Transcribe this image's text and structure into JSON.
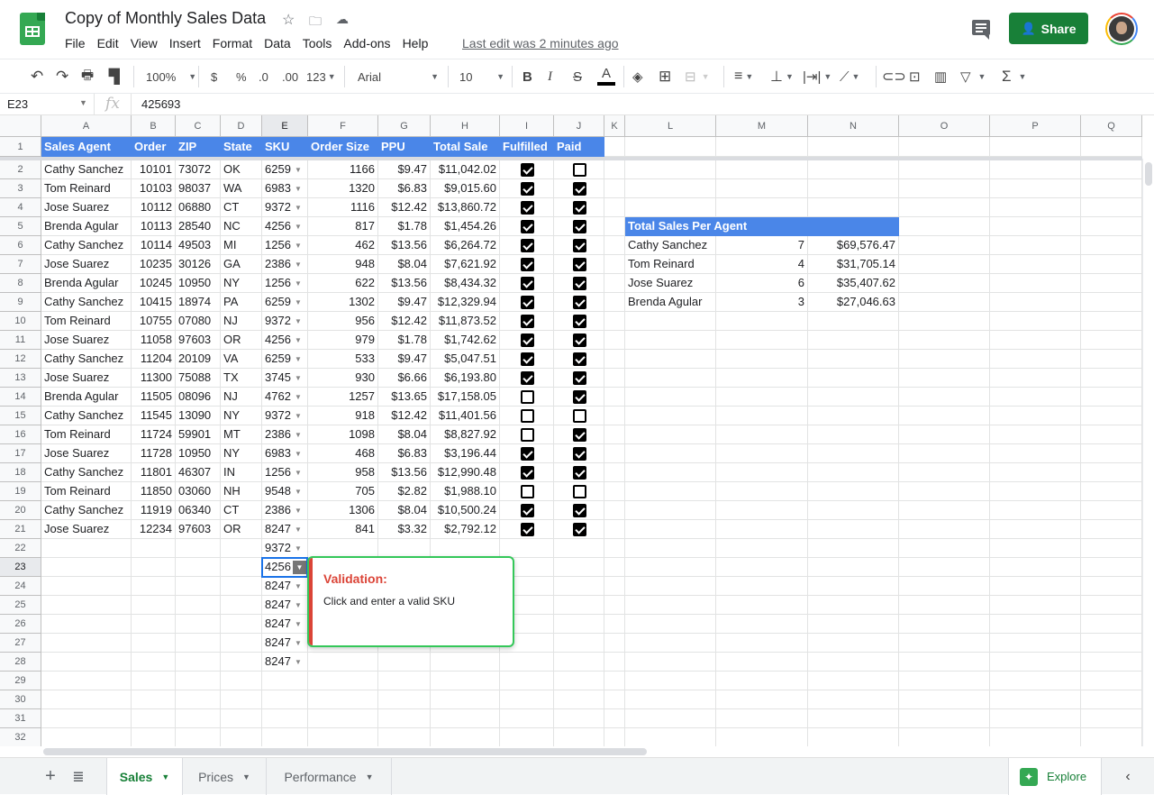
{
  "app": {
    "doc_title": "Copy of Monthly Sales Data",
    "menu": [
      "File",
      "Edit",
      "View",
      "Insert",
      "Format",
      "Data",
      "Tools",
      "Add-ons",
      "Help"
    ],
    "last_edit": "Last edit was 2 minutes ago",
    "share_label": "Share"
  },
  "toolbar": {
    "zoom": "100%",
    "currency": "$",
    "percent": "%",
    "dec_decrease": ".0",
    "dec_increase": ".00",
    "more_formats": "123",
    "font": "Arial",
    "font_size": "10",
    "bold": "B",
    "italic": "I",
    "strike": "S",
    "text_color": "A",
    "functions": "Σ"
  },
  "formula_bar": {
    "cell_ref": "E23",
    "fx": "fx",
    "value": "425693"
  },
  "columns": [
    "A",
    "B",
    "C",
    "D",
    "E",
    "F",
    "G",
    "H",
    "I",
    "J",
    "K",
    "L",
    "M",
    "N",
    "O",
    "P",
    "Q"
  ],
  "selected_column": "E",
  "selected_row": 23,
  "header_row": [
    "Sales Agent",
    "Order",
    "ZIP",
    "State",
    "SKU",
    "Order Size",
    "PPU",
    "Total Sale",
    "Fulfilled",
    "Paid"
  ],
  "rows": [
    {
      "agent": "Cathy Sanchez",
      "order": "10101",
      "zip": "73072",
      "state": "OK",
      "sku": "6259",
      "size": "1166",
      "ppu": "$9.47",
      "total": "$11,042.02",
      "fulfilled": true,
      "paid": false
    },
    {
      "agent": "Tom Reinard",
      "order": "10103",
      "zip": "98037",
      "state": "WA",
      "sku": "6983",
      "size": "1320",
      "ppu": "$6.83",
      "total": "$9,015.60",
      "fulfilled": true,
      "paid": true
    },
    {
      "agent": "Jose Suarez",
      "order": "10112",
      "zip": "06880",
      "state": "CT",
      "sku": "9372",
      "size": "1116",
      "ppu": "$12.42",
      "total": "$13,860.72",
      "fulfilled": true,
      "paid": true
    },
    {
      "agent": "Brenda Agular",
      "order": "10113",
      "zip": "28540",
      "state": "NC",
      "sku": "4256",
      "size": "817",
      "ppu": "$1.78",
      "total": "$1,454.26",
      "fulfilled": true,
      "paid": true
    },
    {
      "agent": "Cathy Sanchez",
      "order": "10114",
      "zip": "49503",
      "state": "MI",
      "sku": "1256",
      "size": "462",
      "ppu": "$13.56",
      "total": "$6,264.72",
      "fulfilled": true,
      "paid": true
    },
    {
      "agent": "Jose Suarez",
      "order": "10235",
      "zip": "30126",
      "state": "GA",
      "sku": "2386",
      "size": "948",
      "ppu": "$8.04",
      "total": "$7,621.92",
      "fulfilled": true,
      "paid": true
    },
    {
      "agent": "Brenda Agular",
      "order": "10245",
      "zip": "10950",
      "state": "NY",
      "sku": "1256",
      "size": "622",
      "ppu": "$13.56",
      "total": "$8,434.32",
      "fulfilled": true,
      "paid": true
    },
    {
      "agent": "Cathy Sanchez",
      "order": "10415",
      "zip": "18974",
      "state": "PA",
      "sku": "6259",
      "size": "1302",
      "ppu": "$9.47",
      "total": "$12,329.94",
      "fulfilled": true,
      "paid": true
    },
    {
      "agent": "Tom Reinard",
      "order": "10755",
      "zip": "07080",
      "state": "NJ",
      "sku": "9372",
      "size": "956",
      "ppu": "$12.42",
      "total": "$11,873.52",
      "fulfilled": true,
      "paid": true
    },
    {
      "agent": "Jose Suarez",
      "order": "11058",
      "zip": "97603",
      "state": "OR",
      "sku": "4256",
      "size": "979",
      "ppu": "$1.78",
      "total": "$1,742.62",
      "fulfilled": true,
      "paid": true
    },
    {
      "agent": "Cathy Sanchez",
      "order": "11204",
      "zip": "20109",
      "state": "VA",
      "sku": "6259",
      "size": "533",
      "ppu": "$9.47",
      "total": "$5,047.51",
      "fulfilled": true,
      "paid": true
    },
    {
      "agent": "Jose Suarez",
      "order": "11300",
      "zip": "75088",
      "state": "TX",
      "sku": "3745",
      "size": "930",
      "ppu": "$6.66",
      "total": "$6,193.80",
      "fulfilled": true,
      "paid": true
    },
    {
      "agent": "Brenda Agular",
      "order": "11505",
      "zip": "08096",
      "state": "NJ",
      "sku": "4762",
      "size": "1257",
      "ppu": "$13.65",
      "total": "$17,158.05",
      "fulfilled": false,
      "paid": true
    },
    {
      "agent": "Cathy Sanchez",
      "order": "11545",
      "zip": "13090",
      "state": "NY",
      "sku": "9372",
      "size": "918",
      "ppu": "$12.42",
      "total": "$11,401.56",
      "fulfilled": false,
      "paid": false
    },
    {
      "agent": "Tom Reinard",
      "order": "11724",
      "zip": "59901",
      "state": "MT",
      "sku": "2386",
      "size": "1098",
      "ppu": "$8.04",
      "total": "$8,827.92",
      "fulfilled": false,
      "paid": true
    },
    {
      "agent": "Jose Suarez",
      "order": "11728",
      "zip": "10950",
      "state": "NY",
      "sku": "6983",
      "size": "468",
      "ppu": "$6.83",
      "total": "$3,196.44",
      "fulfilled": true,
      "paid": true
    },
    {
      "agent": "Cathy Sanchez",
      "order": "11801",
      "zip": "46307",
      "state": "IN",
      "sku": "1256",
      "size": "958",
      "ppu": "$13.56",
      "total": "$12,990.48",
      "fulfilled": true,
      "paid": true
    },
    {
      "agent": "Tom Reinard",
      "order": "11850",
      "zip": "03060",
      "state": "NH",
      "sku": "9548",
      "size": "705",
      "ppu": "$2.82",
      "total": "$1,988.10",
      "fulfilled": false,
      "paid": false
    },
    {
      "agent": "Cathy Sanchez",
      "order": "11919",
      "zip": "06340",
      "state": "CT",
      "sku": "2386",
      "size": "1306",
      "ppu": "$8.04",
      "total": "$10,500.24",
      "fulfilled": true,
      "paid": true
    },
    {
      "agent": "Jose Suarez",
      "order": "12234",
      "zip": "97603",
      "state": "OR",
      "sku": "8247",
      "size": "841",
      "ppu": "$3.32",
      "total": "$2,792.12",
      "fulfilled": true,
      "paid": true
    }
  ],
  "extra_sku_rows": [
    "9372",
    "4256",
    "8247",
    "8247",
    "8247",
    "8247",
    "8247"
  ],
  "summary": {
    "title": "Total Sales Per Agent",
    "rows": [
      {
        "agent": "Cathy Sanchez",
        "count": "7",
        "total": "$69,576.47"
      },
      {
        "agent": "Tom Reinard",
        "count": "4",
        "total": "$31,705.14"
      },
      {
        "agent": "Jose Suarez",
        "count": "6",
        "total": "$35,407.62"
      },
      {
        "agent": "Brenda Agular",
        "count": "3",
        "total": "$27,046.63"
      }
    ]
  },
  "validation": {
    "title": "Validation:",
    "message": "Click and enter a valid SKU"
  },
  "sheet_tabs": [
    {
      "label": "Sales",
      "active": true
    },
    {
      "label": "Prices",
      "active": false
    },
    {
      "label": "Performance",
      "active": false
    }
  ],
  "explore_label": "Explore",
  "colors": {
    "header_blue": "#4a86e8",
    "brand_green": "#188038",
    "validation_red": "#db4437",
    "tooltip_border": "#34c759"
  }
}
